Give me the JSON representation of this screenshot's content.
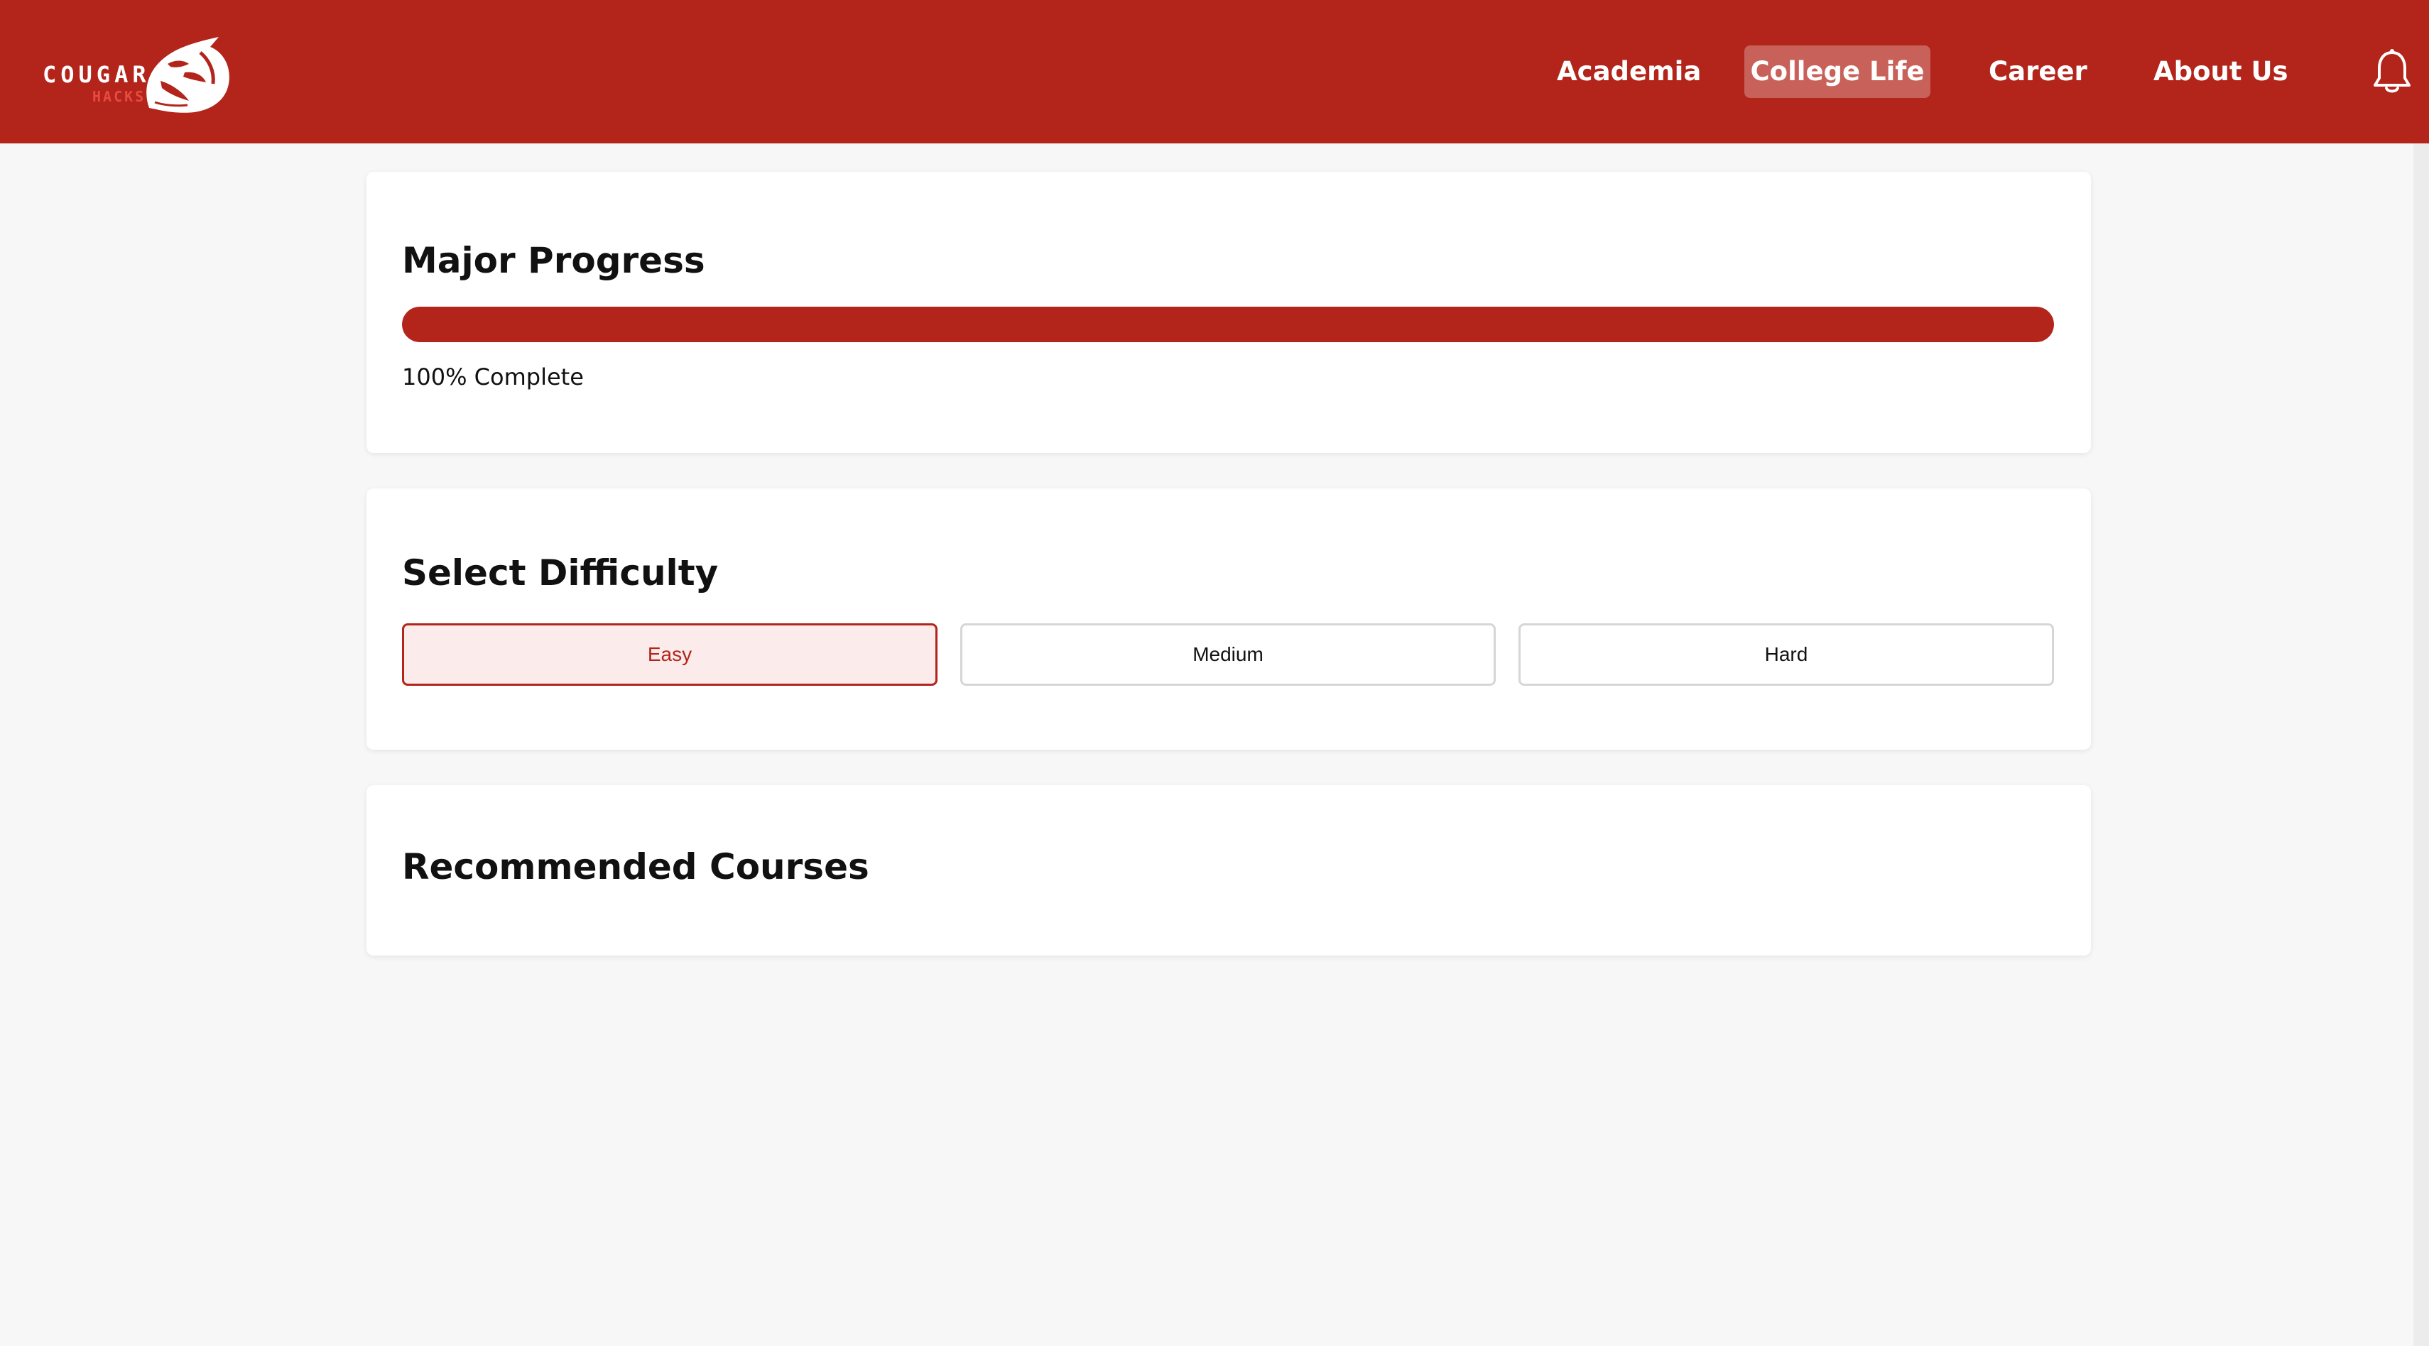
{
  "header": {
    "logo": {
      "word": "COUGAR",
      "sub": "HACKS"
    },
    "nav": [
      {
        "label": "Academia",
        "active": false
      },
      {
        "label": "College Life",
        "active": true
      },
      {
        "label": "Career",
        "active": false
      },
      {
        "label": "About Us",
        "active": false
      }
    ],
    "notification_icon": "bell-icon"
  },
  "progress": {
    "title": "Major Progress",
    "percent": 100,
    "status_text": "100% Complete"
  },
  "difficulty": {
    "title": "Select Difficulty",
    "options": [
      {
        "label": "Easy",
        "selected": true
      },
      {
        "label": "Medium",
        "selected": false
      },
      {
        "label": "Hard",
        "selected": false
      }
    ]
  },
  "courses": {
    "title": "Recommended Courses"
  },
  "colors": {
    "brand": "#b3241b",
    "background": "#f7f7f7",
    "selected_bg": "#fcebeb"
  }
}
